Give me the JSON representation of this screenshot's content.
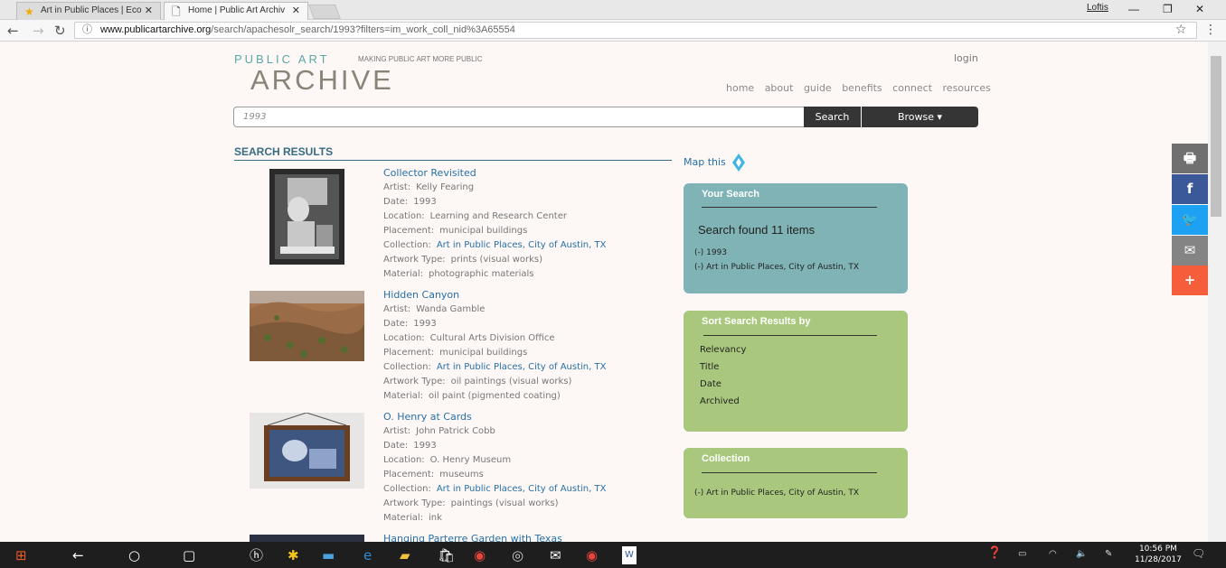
{
  "browser": {
    "tabs": [
      {
        "label": "Art in Public Places | Eco",
        "icon": "star-favicon",
        "active": false
      },
      {
        "label": "Home | Public Art Archiv",
        "icon": "page-icon",
        "active": true
      }
    ],
    "window_user": "Loftis",
    "url_domain": "www.publicartarchive.org",
    "url_path": "/search/apachesolr_search/1993?filters=im_work_coll_nid%3A65554"
  },
  "header": {
    "logo_top": "PUBLIC ART",
    "tagline": "MAKING PUBLIC ART MORE PUBLIC",
    "logo_bottom": "ARCHIVE",
    "login": "login",
    "nav": [
      "home",
      "about",
      "guide",
      "benefits",
      "connect",
      "resources"
    ]
  },
  "search": {
    "query": "1993",
    "search_label": "Search",
    "browse_label": "Browse ▾"
  },
  "results_heading": "SEARCH RESULTS",
  "map_this": "Map this",
  "labels": {
    "artist": "Artist:",
    "date": "Date:",
    "location": "Location:",
    "placement": "Placement:",
    "collection": "Collection:",
    "type": "Artwork Type:",
    "material": "Material:"
  },
  "results": [
    {
      "title": "Collector Revisited",
      "artist": "Kelly Fearing",
      "date": "1993",
      "location": "Learning and Research Center",
      "placement": "municipal buildings",
      "collection": "Art in Public Places, City of Austin, TX",
      "type": "prints (visual works)",
      "material": "photographic materials"
    },
    {
      "title": "Hidden Canyon",
      "artist": "Wanda Gamble",
      "date": "1993",
      "location": "Cultural Arts Division Office",
      "placement": "municipal buildings",
      "collection": "Art in Public Places, City of Austin, TX",
      "type": "oil paintings (visual works)",
      "material": "oil paint (pigmented coating)"
    },
    {
      "title": "O. Henry at Cards",
      "artist": "John Patrick Cobb",
      "date": "1993",
      "location": "O. Henry Museum",
      "placement": "museums",
      "collection": "Art in Public Places, City of Austin, TX",
      "type": "paintings (visual works)",
      "material": "ink"
    },
    {
      "title": "Hanging Parterre Garden with Texas"
    }
  ],
  "your_search": {
    "heading": "Your Search",
    "found": "Search found 11 items",
    "filters": [
      "(-)  1993",
      "(-)  Art in Public Places, City of Austin, TX"
    ]
  },
  "sort": {
    "heading": "Sort Search Results by",
    "options": [
      "Relevancy",
      "Title",
      "Date",
      "Archived"
    ]
  },
  "collection_box": {
    "heading": "Collection",
    "item": "(-) Art in Public Places, City of Austin, TX"
  },
  "share": [
    {
      "icon": "print-icon",
      "color": "#707070"
    },
    {
      "icon": "facebook-icon",
      "color": "#3b5998"
    },
    {
      "icon": "twitter-icon",
      "color": "#1da1f2"
    },
    {
      "icon": "email-icon",
      "color": "#848484"
    },
    {
      "icon": "plus-icon",
      "color": "#f65e3b"
    }
  ],
  "taskbar": {
    "time": "10:56 PM",
    "date": "11/28/2017"
  }
}
